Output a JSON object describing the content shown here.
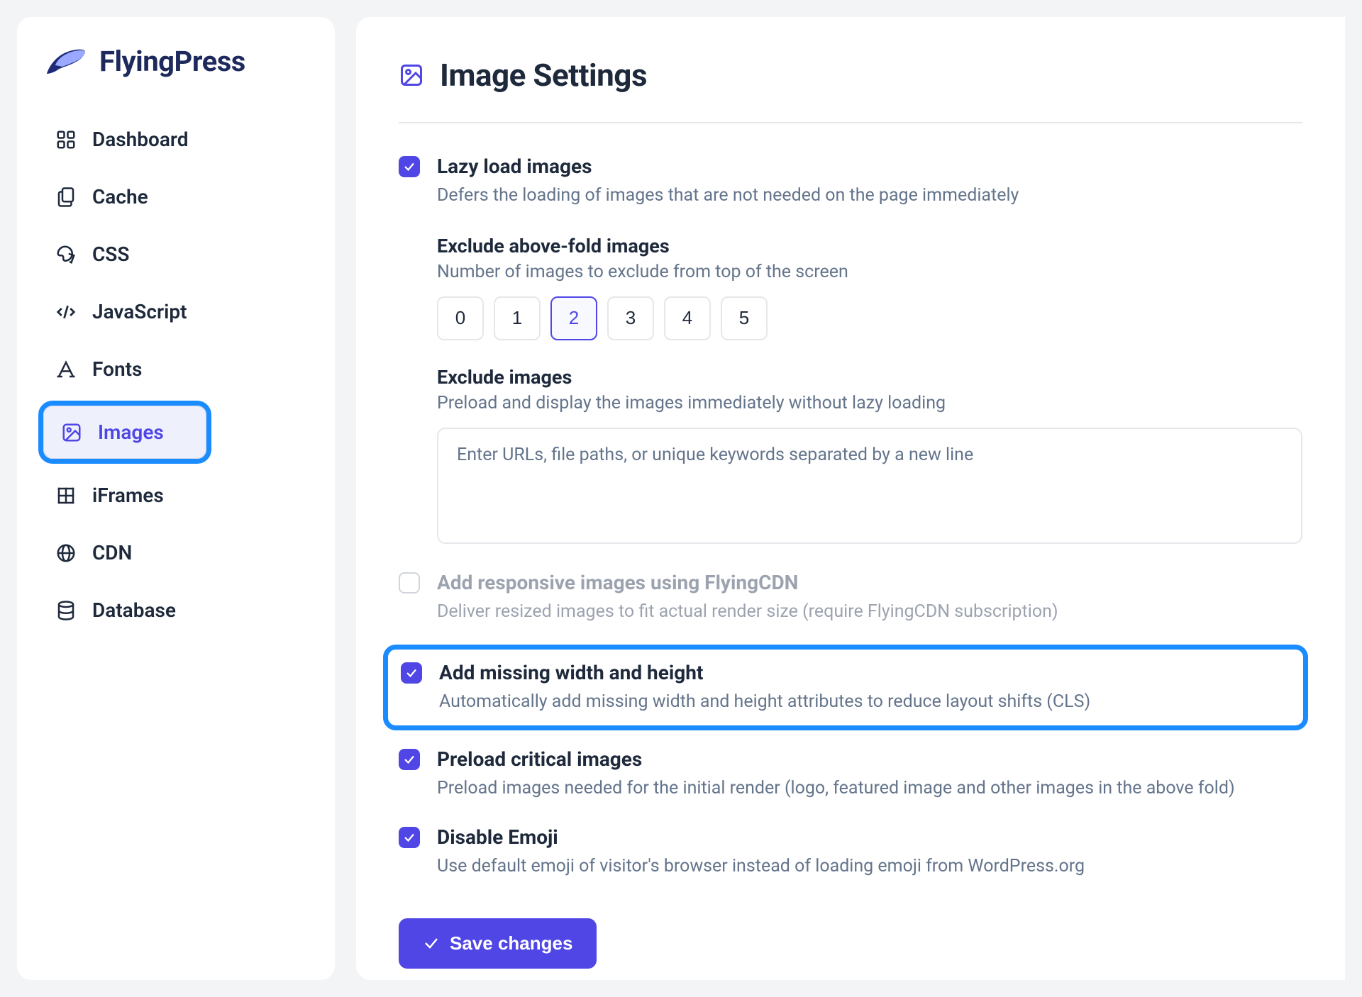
{
  "app": {
    "name": "FlyingPress"
  },
  "sidebar": {
    "items": [
      {
        "label": "Dashboard"
      },
      {
        "label": "Cache"
      },
      {
        "label": "CSS"
      },
      {
        "label": "JavaScript"
      },
      {
        "label": "Fonts"
      },
      {
        "label": "Images"
      },
      {
        "label": "iFrames"
      },
      {
        "label": "CDN"
      },
      {
        "label": "Database"
      }
    ],
    "active_index": 5
  },
  "page": {
    "title": "Image Settings"
  },
  "settings": {
    "lazy_load": {
      "checked": true,
      "title": "Lazy load images",
      "desc": "Defers the loading of images that are not needed on the page immediately"
    },
    "exclude_above_fold": {
      "title": "Exclude above-fold images",
      "desc": "Number of images to exclude from top of the screen",
      "options": [
        "0",
        "1",
        "2",
        "3",
        "4",
        "5"
      ],
      "selected": "2"
    },
    "exclude_images": {
      "title": "Exclude images",
      "desc": "Preload and display the images immediately without lazy loading",
      "placeholder": "Enter URLs, file paths, or unique keywords separated by a new line"
    },
    "responsive_cdn": {
      "checked": false,
      "disabled": true,
      "title": "Add responsive images using FlyingCDN",
      "desc": "Deliver resized images to fit actual render size (require FlyingCDN subscription)"
    },
    "add_dimensions": {
      "checked": true,
      "highlighted": true,
      "title": "Add missing width and height",
      "desc": "Automatically add missing width and height attributes to reduce layout shifts (CLS)"
    },
    "preload_critical": {
      "checked": true,
      "title": "Preload critical images",
      "desc": "Preload images needed for the initial render (logo, featured image and other images in the above fold)"
    },
    "disable_emoji": {
      "checked": true,
      "title": "Disable Emoji",
      "desc": "Use default emoji of visitor's browser instead of loading emoji from WordPress.org"
    }
  },
  "actions": {
    "save": "Save changes"
  }
}
